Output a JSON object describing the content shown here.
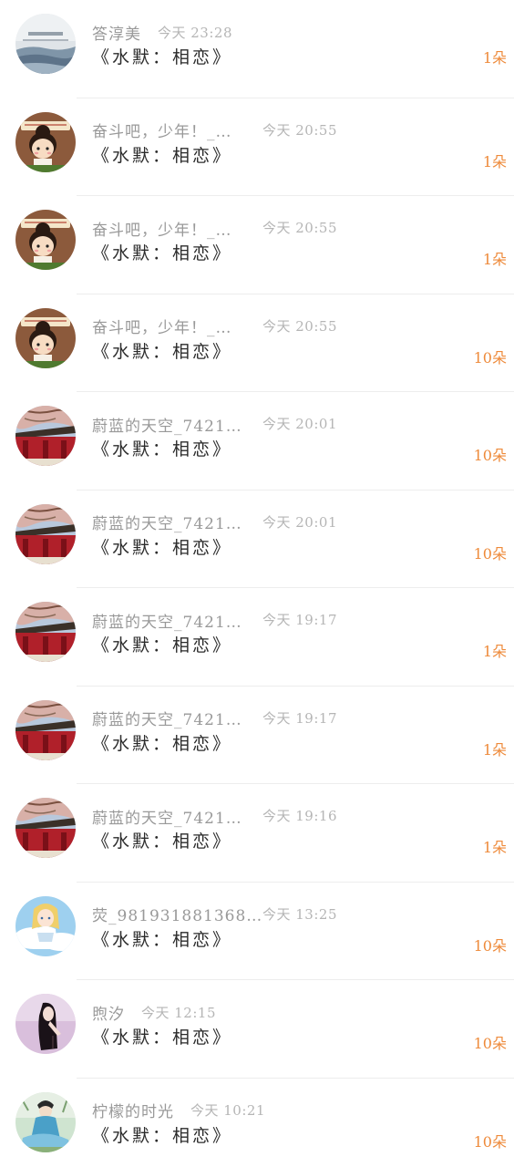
{
  "gift_list": {
    "items": [
      {
        "name": "答淳美",
        "time": "今天 23:28",
        "title": "《水默：相恋》",
        "count": "1朵",
        "avatar": "landscape-avatar"
      },
      {
        "name": "奋斗吧，少年！_…",
        "time": "今天 20:55",
        "title": "《水默：相恋》",
        "count": "1朵",
        "avatar": "cartoon-girl-avatar"
      },
      {
        "name": "奋斗吧，少年！_…",
        "time": "今天 20:55",
        "title": "《水默：相恋》",
        "count": "1朵",
        "avatar": "cartoon-girl-avatar"
      },
      {
        "name": "奋斗吧，少年！_…",
        "time": "今天 20:55",
        "title": "《水默：相恋》",
        "count": "10朵",
        "avatar": "cartoon-girl-avatar"
      },
      {
        "name": "蔚蓝的天空_7421…",
        "time": "今天 20:01",
        "title": "《水默：相恋》",
        "count": "10朵",
        "avatar": "palace-avatar"
      },
      {
        "name": "蔚蓝的天空_7421…",
        "time": "今天 20:01",
        "title": "《水默：相恋》",
        "count": "10朵",
        "avatar": "palace-avatar"
      },
      {
        "name": "蔚蓝的天空_7421…",
        "time": "今天 19:17",
        "title": "《水默：相恋》",
        "count": "1朵",
        "avatar": "palace-avatar"
      },
      {
        "name": "蔚蓝的天空_7421…",
        "time": "今天 19:17",
        "title": "《水默：相恋》",
        "count": "1朵",
        "avatar": "palace-avatar"
      },
      {
        "name": "蔚蓝的天空_7421…",
        "time": "今天 19:16",
        "title": "《水默：相恋》",
        "count": "1朵",
        "avatar": "palace-avatar"
      },
      {
        "name": "荧_981931881368…",
        "time": "今天 13:25",
        "title": "《水默：相恋》",
        "count": "10朵",
        "avatar": "anime-girl-avatar"
      },
      {
        "name": "煦汐",
        "time": "今天 12:15",
        "title": "《水默：相恋》",
        "count": "10朵",
        "avatar": "dark-hair-girl-avatar"
      },
      {
        "name": "柠檬的时光",
        "time": "今天 10:21",
        "title": "《水默：相恋》",
        "count": "10朵",
        "avatar": "blue-costume-avatar"
      }
    ]
  },
  "colors": {
    "count": "#ee8a3a",
    "name": "#999999",
    "time": "#b5b5b5",
    "title": "#2b2b2b",
    "divider": "#ededed"
  }
}
